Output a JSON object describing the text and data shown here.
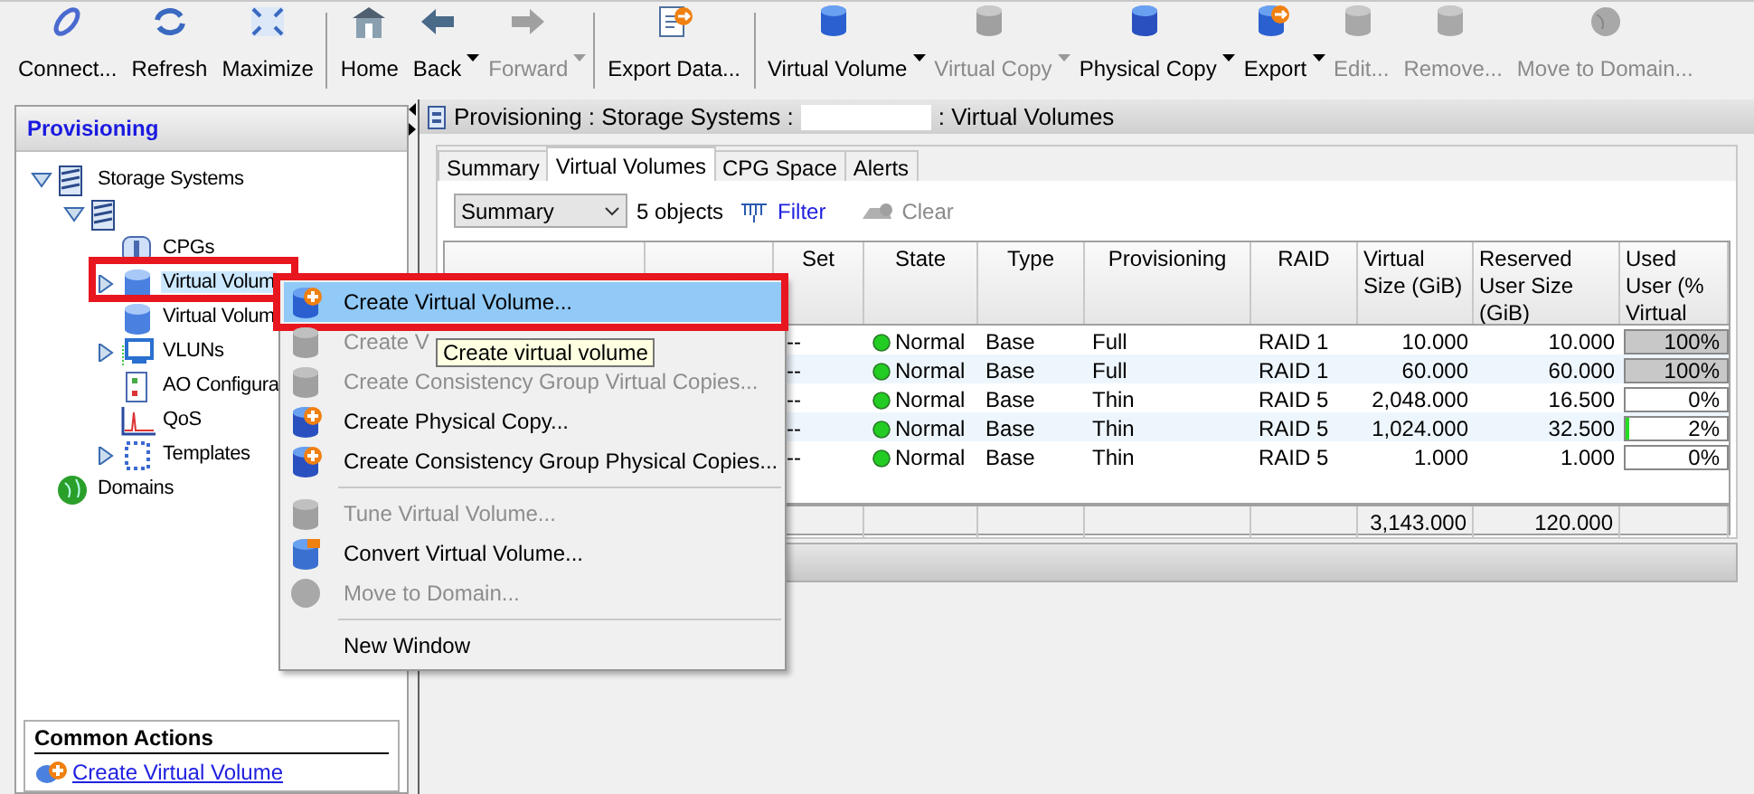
{
  "toolbar": [
    {
      "label": "Connect...",
      "disabled": false,
      "dropdown": false,
      "separator_after": false
    },
    {
      "label": "Refresh",
      "disabled": false,
      "dropdown": false,
      "separator_after": false
    },
    {
      "label": "Maximize",
      "disabled": false,
      "dropdown": false,
      "separator_after": true
    },
    {
      "label": "Home",
      "disabled": false,
      "dropdown": false,
      "separator_after": false
    },
    {
      "label": "Back",
      "disabled": false,
      "dropdown": true,
      "separator_after": false
    },
    {
      "label": "Forward",
      "disabled": true,
      "dropdown": true,
      "separator_after": true
    },
    {
      "label": "Export Data...",
      "disabled": false,
      "dropdown": false,
      "separator_after": true
    },
    {
      "label": "Virtual Volume",
      "disabled": false,
      "dropdown": true,
      "separator_after": false
    },
    {
      "label": "Virtual Copy",
      "disabled": true,
      "dropdown": true,
      "separator_after": false
    },
    {
      "label": "Physical Copy",
      "disabled": false,
      "dropdown": true,
      "separator_after": false
    },
    {
      "label": "Export",
      "disabled": false,
      "dropdown": true,
      "separator_after": false
    },
    {
      "label": "Edit...",
      "disabled": true,
      "dropdown": false,
      "separator_after": false
    },
    {
      "label": "Remove...",
      "disabled": true,
      "dropdown": false,
      "separator_after": false
    },
    {
      "label": "Move to Domain...",
      "disabled": true,
      "dropdown": false,
      "separator_after": false
    }
  ],
  "sidebar": {
    "title": "Provisioning",
    "tree": [
      {
        "label": "Storage Systems",
        "expanded": true,
        "selected": false,
        "children": [
          {
            "expanded": true,
            "children": [
              {
                "label": "CPGs",
                "selected": false,
                "highlighted": false
              },
              {
                "label": "Virtual Volum",
                "expanded": false,
                "selected": true,
                "highlighted": true
              },
              {
                "label": "Virtual Volum",
                "selected": false,
                "highlighted": false
              },
              {
                "label": "VLUNs",
                "expanded": false,
                "selected": false,
                "highlighted": false
              },
              {
                "label": "AO Configura",
                "selected": false,
                "highlighted": false
              },
              {
                "label": "QoS",
                "selected": false,
                "highlighted": false
              },
              {
                "label": "Templates",
                "expanded": false,
                "selected": false,
                "highlighted": false
              }
            ]
          }
        ]
      },
      {
        "label": "Domains",
        "selected": false
      }
    ],
    "common_actions": {
      "title": "Common Actions",
      "links": [
        "Create Virtual Volume"
      ]
    }
  },
  "main": {
    "breadcrumb_left": "Provisioning : Storage Systems :",
    "breadcrumb_right": ": Virtual Volumes",
    "tabs": [
      {
        "label": "Summary",
        "selected": false
      },
      {
        "label": "Virtual Volumes",
        "selected": true
      },
      {
        "label": "CPG Space",
        "selected": false
      },
      {
        "label": "Alerts",
        "selected": false
      }
    ],
    "view_select": {
      "value": "Summary"
    },
    "object_count": "5 objects",
    "filter": "Filter",
    "clear": {
      "label": "Clear",
      "disabled": true
    },
    "table": {
      "columns": [
        "Set",
        "State",
        "Type",
        "Provisioning",
        "RAID",
        "Virtual Size (GiB)",
        "Reserved User Size (GiB)",
        "Used User (% Virtual"
      ],
      "rows": [
        {
          "set": "--",
          "state": "Normal",
          "type": "Base",
          "provisioning": "Full",
          "raid": "RAID 1",
          "virtual_size": "10.000",
          "reserved": "10.000",
          "used": "100%",
          "level": 1
        },
        {
          "set": "--",
          "state": "Normal",
          "type": "Base",
          "provisioning": "Full",
          "raid": "RAID 1",
          "virtual_size": "60.000",
          "reserved": "60.000",
          "used": "100%",
          "level": 1
        },
        {
          "set": "--",
          "state": "Normal",
          "type": "Base",
          "provisioning": "Thin",
          "raid": "RAID 5",
          "virtual_size": "2,048.000",
          "reserved": "16.500",
          "used": "0%",
          "level": 0
        },
        {
          "set": "--",
          "state": "Normal",
          "type": "Base",
          "provisioning": "Thin",
          "raid": "RAID 5",
          "virtual_size": "1,024.000",
          "reserved": "32.500",
          "used": "2%",
          "level": 0.02
        },
        {
          "set": "--",
          "state": "Normal",
          "type": "Base",
          "provisioning": "Thin",
          "raid": "RAID 5",
          "virtual_size": "1.000",
          "reserved": "1.000",
          "used": "0%",
          "level": 0
        }
      ],
      "totals": {
        "virtual_size": "3,143.000",
        "reserved": "120.000"
      }
    }
  },
  "context_menu": [
    {
      "kind": "item",
      "label": "Create Virtual Volume...",
      "disabled": false,
      "selected": true,
      "highlighted": true
    },
    {
      "kind": "item",
      "label": "Create V",
      "disabled": true,
      "selected": false,
      "highlighted": false
    },
    {
      "kind": "item",
      "label": "Create Consistency Group Virtual Copies...",
      "disabled": true,
      "selected": false,
      "highlighted": false
    },
    {
      "kind": "item",
      "label": "Create Physical Copy...",
      "disabled": false,
      "selected": false,
      "highlighted": false
    },
    {
      "kind": "item",
      "label": "Create Consistency Group Physical Copies...",
      "disabled": false,
      "selected": false,
      "highlighted": false
    },
    {
      "kind": "separator"
    },
    {
      "kind": "item",
      "label": "Tune Virtual Volume...",
      "disabled": true,
      "selected": false,
      "highlighted": false
    },
    {
      "kind": "item",
      "label": "Convert Virtual Volume...",
      "disabled": false,
      "selected": false,
      "highlighted": false
    },
    {
      "kind": "item",
      "label": "Move to Domain...",
      "disabled": true,
      "selected": false,
      "highlighted": false
    },
    {
      "kind": "separator"
    },
    {
      "kind": "item",
      "label": "New Window",
      "disabled": false,
      "selected": false,
      "highlighted": false
    }
  ],
  "tooltip": "Create virtual volume"
}
